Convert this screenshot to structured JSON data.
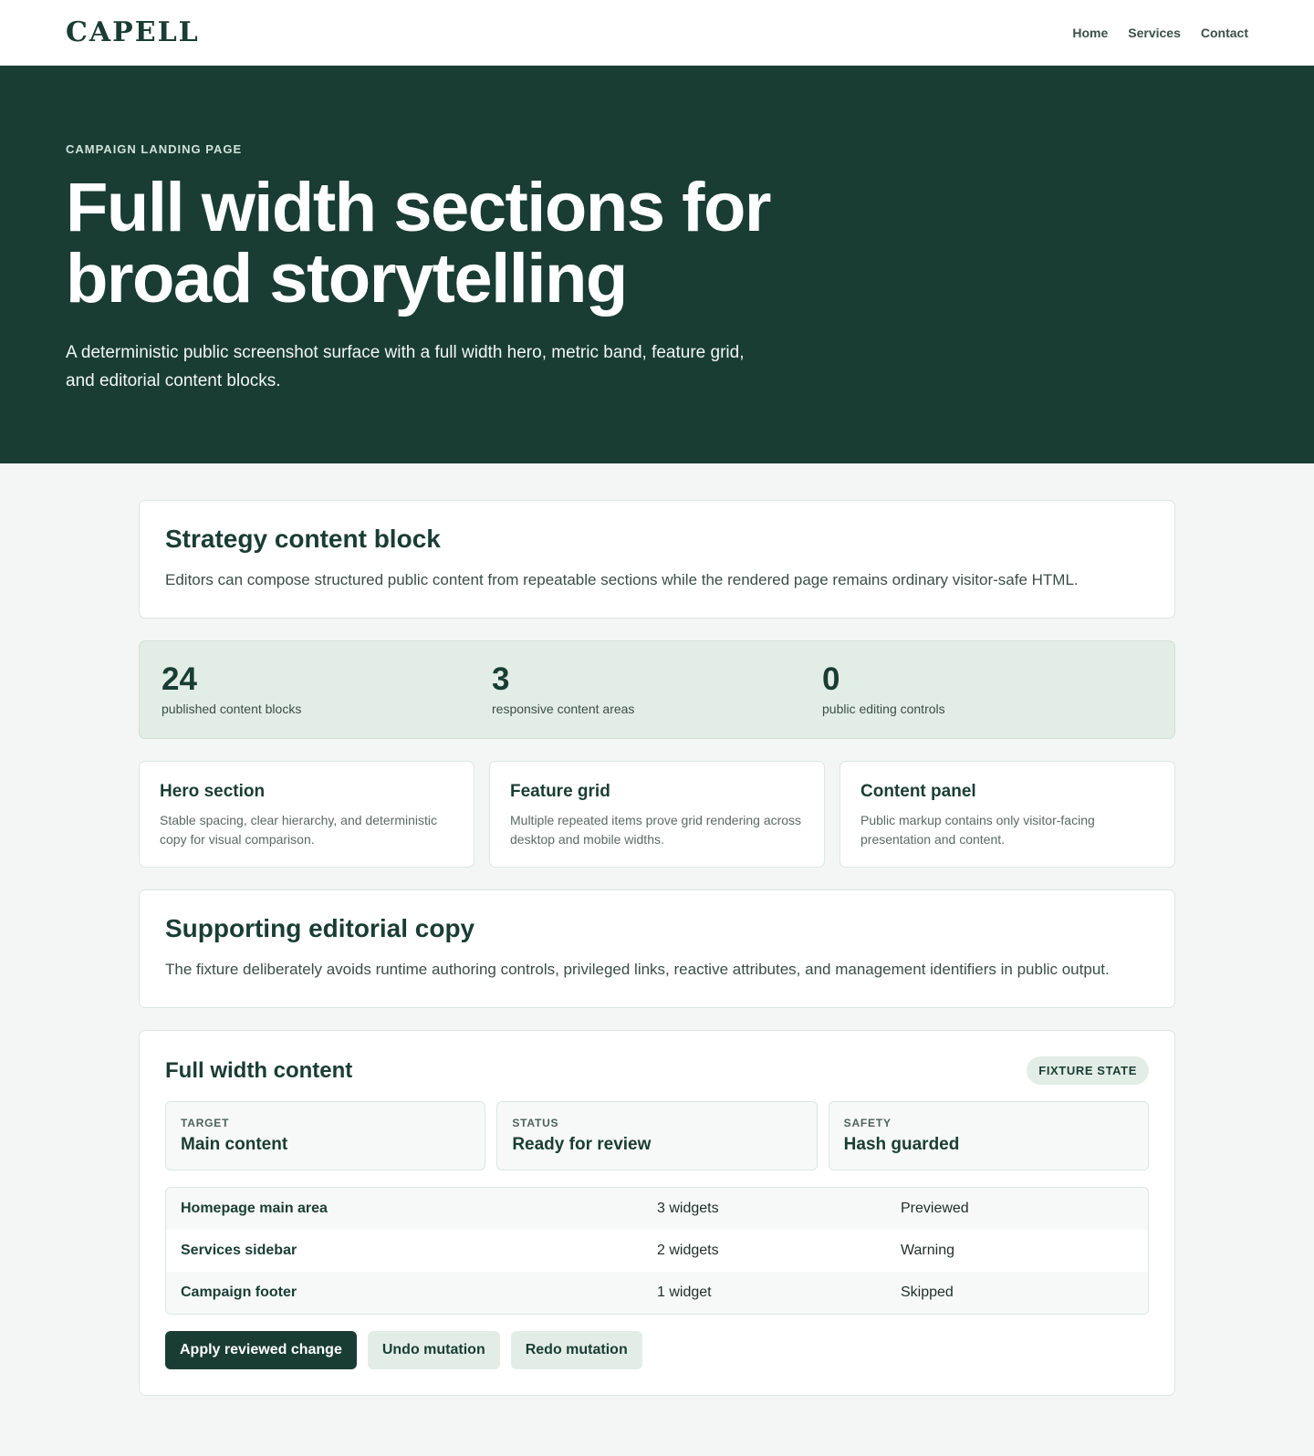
{
  "header": {
    "logo": "CAPELL",
    "nav": [
      "Home",
      "Services",
      "Contact"
    ]
  },
  "hero": {
    "eyebrow": "CAMPAIGN LANDING PAGE",
    "title": "Full width sections for broad storytelling",
    "description": "A deterministic public screenshot surface with a full width hero, metric band, feature grid, and editorial content blocks."
  },
  "strategy": {
    "title": "Strategy content block",
    "body": "Editors can compose structured public content from repeatable sections while the rendered page remains ordinary visitor-safe HTML."
  },
  "metrics": [
    {
      "value": "24",
      "label": "published content blocks"
    },
    {
      "value": "3",
      "label": "responsive content areas"
    },
    {
      "value": "0",
      "label": "public editing controls"
    }
  ],
  "features": [
    {
      "title": "Hero section",
      "body": "Stable spacing, clear hierarchy, and deterministic copy for visual comparison."
    },
    {
      "title": "Feature grid",
      "body": "Multiple repeated items prove grid rendering across desktop and mobile widths."
    },
    {
      "title": "Content panel",
      "body": "Public markup contains only visitor-facing presentation and content."
    }
  ],
  "editorial": {
    "title": "Supporting editorial copy",
    "body": "The fixture deliberately avoids runtime authoring controls, privileged links, reactive attributes, and management identifiers in public output."
  },
  "panel": {
    "title": "Full width content",
    "badge": "FIXTURE STATE",
    "stats": [
      {
        "label": "TARGET",
        "value": "Main content"
      },
      {
        "label": "STATUS",
        "value": "Ready for review"
      },
      {
        "label": "SAFETY",
        "value": "Hash guarded"
      }
    ],
    "rows": [
      {
        "name": "Homepage main area",
        "count": "3 widgets",
        "state": "Previewed"
      },
      {
        "name": "Services sidebar",
        "count": "2 widgets",
        "state": "Warning"
      },
      {
        "name": "Campaign footer",
        "count": "1 widget",
        "state": "Skipped"
      }
    ],
    "actions": {
      "apply": "Apply reviewed change",
      "undo": "Undo mutation",
      "redo": "Redo mutation"
    }
  }
}
